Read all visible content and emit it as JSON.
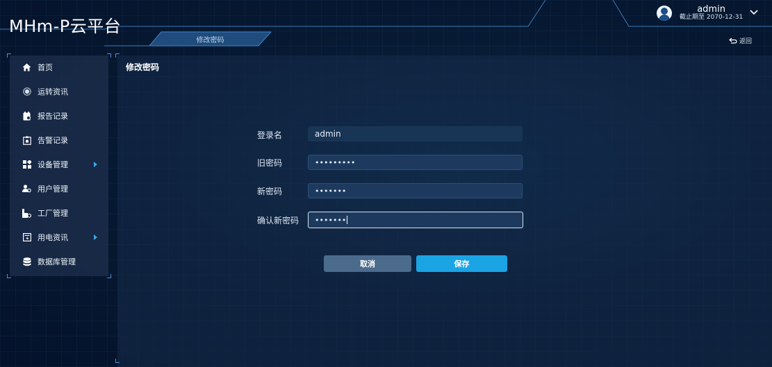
{
  "app": {
    "logo": "MHm-P云平台"
  },
  "header": {
    "sub_tab": "修改密码",
    "back_label": "返回",
    "user": {
      "name": "admin",
      "expire": "截止期至 2070-12-31"
    }
  },
  "sidebar": {
    "items": [
      {
        "label": "首页",
        "icon": "home-icon",
        "has_submenu": false
      },
      {
        "label": "运转资讯",
        "icon": "record-icon",
        "has_submenu": false
      },
      {
        "label": "报告记录",
        "icon": "report-icon",
        "has_submenu": false
      },
      {
        "label": "告警记录",
        "icon": "alarm-icon",
        "has_submenu": false
      },
      {
        "label": "设备管理",
        "icon": "device-icon",
        "has_submenu": true
      },
      {
        "label": "用户管理",
        "icon": "users-icon",
        "has_submenu": false
      },
      {
        "label": "工厂管理",
        "icon": "factory-icon",
        "has_submenu": false
      },
      {
        "label": "用电资讯",
        "icon": "electricity-icon",
        "has_submenu": true
      },
      {
        "label": "数据库管理",
        "icon": "database-icon",
        "has_submenu": false
      }
    ]
  },
  "panel": {
    "title": "修改密码",
    "form": {
      "login_label": "登录名",
      "login_value": "admin",
      "old_password_label": "旧密码",
      "old_password_value": "•••••••••",
      "new_password_label": "新密码",
      "new_password_value": "•••••••",
      "confirm_password_label": "确认新密码",
      "confirm_password_value": "•••••••"
    },
    "buttons": {
      "cancel": "取消",
      "save": "保存"
    }
  },
  "colors": {
    "accent": "#1aa4e4",
    "submenu_arrow": "#34a8ea",
    "background": "#071a33"
  }
}
